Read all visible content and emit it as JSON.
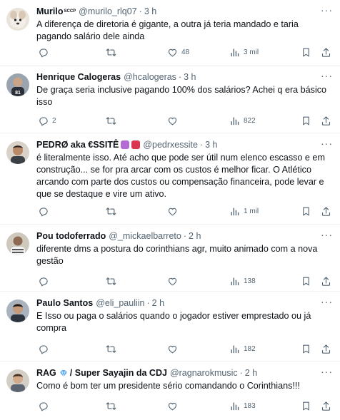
{
  "tweets": [
    {
      "name": "Murilo",
      "name_sup": "SCCP",
      "handle": "@murilo_rlq07",
      "time": "3 h",
      "text": "A diferença de diretoria é gigante, a outra já teria mandado e taria pagando salário dele ainda",
      "replies": "",
      "retweets": "",
      "likes": "48",
      "views": "3 mil"
    },
    {
      "name": "Henrique Calogeras",
      "handle": "@hcalogeras",
      "time": "3 h",
      "text": "De graça seria inclusive pagando 100% dos salários? Achei q era básico isso",
      "replies": "2",
      "retweets": "",
      "likes": "",
      "views": "822"
    },
    {
      "name": "PEDRØ aka €SSITÊ",
      "handle": "@pedrxessite",
      "time": "3 h",
      "text": "é literalmente isso. Até acho que pode ser útil num elenco escasso e em construção... se for pra arcar com os custos é melhor ficar. O Atlético arcando com parte dos custos ou compensação financeira, pode levar e que se destaque e vire um ativo.",
      "replies": "",
      "retweets": "",
      "likes": "",
      "views": "1 mil"
    },
    {
      "name": "Pou todoferrado",
      "handle": "@_mickaelbarreto",
      "time": "2 h",
      "text": "diferente dms a postura do corinthians agr, muito animado com a nova gestão",
      "replies": "",
      "retweets": "",
      "likes": "",
      "views": "138"
    },
    {
      "name": "Paulo Santos",
      "handle": "@eli_pauliin",
      "time": "2 h",
      "text": "E Isso ou paga o salários quando o jogador estiver emprestado ou já compra",
      "replies": "",
      "retweets": "",
      "likes": "",
      "views": "182"
    },
    {
      "name": "RAG",
      "name_suffix": "/ Super Sayajin da CDJ",
      "handle": "@ragnarokmusic",
      "time": "2 h",
      "text": "Como é bom ter um presidente sério comandando o Corinthians!!!",
      "replies": "",
      "retweets": "",
      "likes": "",
      "views": "183"
    }
  ],
  "icons": {
    "reply": "reply-icon",
    "retweet": "retweet-icon",
    "like": "heart-icon",
    "views": "views-icon",
    "bookmark": "bookmark-icon",
    "share": "share-icon",
    "more": "more-icon"
  },
  "colors": {
    "text": "#0f1419",
    "muted": "#536471",
    "divider": "#eff3f4",
    "badge_diamond": "#58a6e8"
  }
}
